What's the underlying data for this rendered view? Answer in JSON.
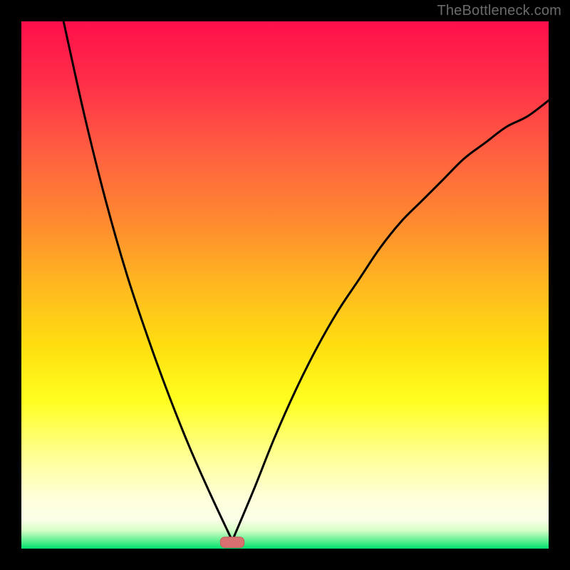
{
  "watermark": "TheBottleneck.com",
  "colors": {
    "frame": "#000000",
    "curve": "#000000",
    "marker_fill": "#d87070",
    "marker_stroke": "#c85a5a",
    "gradient_stops": [
      {
        "offset": 0.0,
        "color": "#ff0f4a"
      },
      {
        "offset": 0.12,
        "color": "#ff3048"
      },
      {
        "offset": 0.25,
        "color": "#ff6040"
      },
      {
        "offset": 0.38,
        "color": "#ff8a30"
      },
      {
        "offset": 0.5,
        "color": "#ffb820"
      },
      {
        "offset": 0.62,
        "color": "#ffe010"
      },
      {
        "offset": 0.72,
        "color": "#ffff20"
      },
      {
        "offset": 0.82,
        "color": "#ffff90"
      },
      {
        "offset": 0.9,
        "color": "#ffffd8"
      },
      {
        "offset": 0.945,
        "color": "#fbffe8"
      },
      {
        "offset": 0.965,
        "color": "#d8ffc8"
      },
      {
        "offset": 0.985,
        "color": "#60f090"
      },
      {
        "offset": 1.0,
        "color": "#00e070"
      }
    ]
  },
  "chart_data": {
    "type": "line",
    "title": "",
    "xlabel": "",
    "ylabel": "",
    "xlim": [
      0,
      100
    ],
    "ylim": [
      0,
      100
    ],
    "optimum_x": 40,
    "series": [
      {
        "name": "left-branch",
        "x": [
          8,
          12,
          16,
          20,
          24,
          28,
          32,
          36,
          40
        ],
        "values": [
          100,
          82,
          66,
          52,
          40,
          29,
          19,
          10,
          1.5
        ]
      },
      {
        "name": "right-branch",
        "x": [
          40,
          44,
          48,
          52,
          56,
          60,
          64,
          68,
          72,
          76,
          80,
          84,
          88,
          92,
          96,
          100
        ],
        "values": [
          1.5,
          11,
          21,
          30,
          38,
          45,
          51,
          57,
          62,
          66,
          70,
          74,
          77,
          80,
          82,
          85
        ]
      }
    ],
    "marker": {
      "x": 40,
      "y": 1.2,
      "width": 4.5,
      "height": 2.0
    }
  }
}
